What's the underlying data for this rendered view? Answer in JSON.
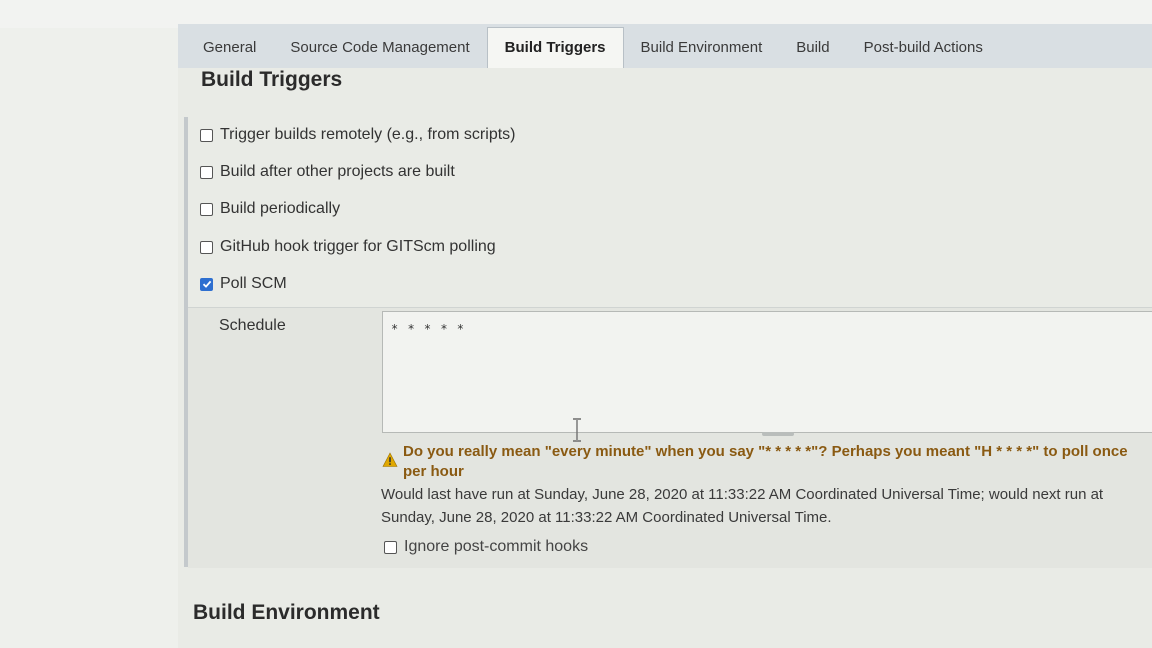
{
  "tabs": [
    {
      "label": "General"
    },
    {
      "label": "Source Code Management"
    },
    {
      "label": "Build Triggers"
    },
    {
      "label": "Build Environment"
    },
    {
      "label": "Build"
    },
    {
      "label": "Post-build Actions"
    }
  ],
  "active_tab": "Build Triggers",
  "build_triggers": {
    "title": "Build Triggers",
    "options": [
      {
        "label": "Trigger builds remotely (e.g., from scripts)",
        "checked": false
      },
      {
        "label": "Build after other projects are built",
        "checked": false
      },
      {
        "label": "Build periodically",
        "checked": false
      },
      {
        "label": "GitHub hook trigger for GITScm polling",
        "checked": false
      },
      {
        "label": "Poll SCM",
        "checked": true
      }
    ],
    "poll_scm": {
      "schedule_label": "Schedule",
      "schedule_value": "* * * * *",
      "warning_line1": "Do you really mean \"every minute\" when you say \"* * * * *\"? Perhaps you meant \"H * * * *\" to poll once",
      "warning_line2": "per hour",
      "info_line1": "Would last have run at Sunday, June 28, 2020 at 11:33:22 AM Coordinated Universal Time; would next run at",
      "info_line2": "Sunday, June 28, 2020 at 11:33:22 AM Coordinated Universal Time.",
      "ignore_hooks_label": "Ignore post-commit hooks",
      "ignore_hooks_checked": false
    }
  },
  "build_environment": {
    "title": "Build Environment"
  },
  "colors": {
    "checkbox_checked": "#2e6fd0",
    "warning_text": "#8a5a12",
    "warning_icon": "#e0a800"
  }
}
